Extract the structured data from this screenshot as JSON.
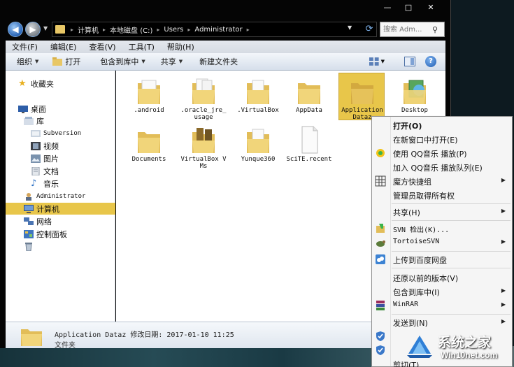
{
  "window": {
    "caption": {
      "minimize": "—",
      "maximize": "□",
      "close": "✕"
    }
  },
  "address": {
    "breadcrumbs": [
      "计算机",
      "本地磁盘 (C:)",
      "Users",
      "Administrator"
    ],
    "search_placeholder": "搜索 Adm..."
  },
  "menubar": {
    "items": [
      "文件(F)",
      "编辑(E)",
      "查看(V)",
      "工具(T)",
      "帮助(H)"
    ]
  },
  "toolbar": {
    "organize": "组织",
    "open": "打开",
    "include_in_library": "包含到库中",
    "share": "共享",
    "new_folder": "新建文件夹"
  },
  "nav_pane": {
    "favorites": "收藏夹",
    "desktop": "桌面",
    "library": "库",
    "subversion": "Subversion",
    "videos": "视频",
    "pictures": "图片",
    "documents": "文档",
    "music": "音乐",
    "administrator": "Administrator",
    "computer": "计算机",
    "network": "网络",
    "control_panel": "控制面板"
  },
  "files": [
    {
      "name": ".android"
    },
    {
      "name": ".oracle_jre_usage"
    },
    {
      "name": ".VirtualBox"
    },
    {
      "name": "AppData"
    },
    {
      "name": "Application Dataz"
    },
    {
      "name": "Desktop"
    },
    {
      "name": "Documents"
    },
    {
      "name": "VirtualBox VMs"
    },
    {
      "name": "Yunque360"
    },
    {
      "name": "SciTE.recent"
    }
  ],
  "details": {
    "name_line": "Application Dataz 修改日期: 2017-01-10 11:25",
    "type": "文件夹"
  },
  "context_menu": {
    "items": [
      "打开(O)",
      "在新窗口中打开(E)",
      "使用 QQ音乐 播放(P)",
      "加入 QQ音乐 播放队列(E)",
      "魔方快捷组",
      "管理员取得所有权",
      "共享(H)",
      "SVN 检出(K)...",
      "TortoiseSVN",
      "上传到百度网盘",
      "还原以前的版本(V)",
      "包含到库中(I)",
      "WinRAR",
      "发送到(N)",
      "剪切(T)"
    ]
  },
  "watermark": {
    "title": "系统之家",
    "subtitle": "Win10net.com"
  },
  "colors": {
    "selection": "#e8c64a",
    "folder": "#e8c766",
    "window_frame": "#050505"
  }
}
